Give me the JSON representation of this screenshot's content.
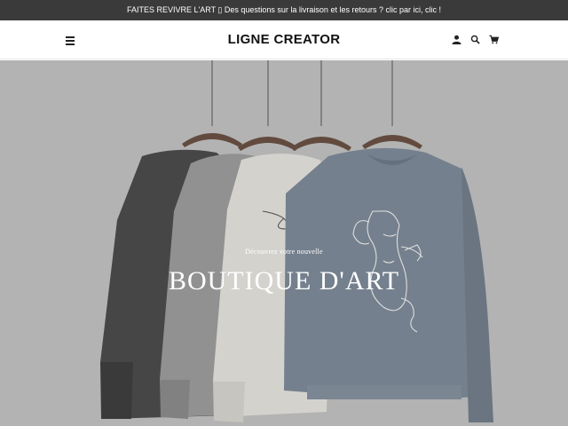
{
  "announcement": {
    "text": "FAITES REVIVRE L'ART ▯ Des questions sur la livraison et les retours ? clic par ici, clic !"
  },
  "header": {
    "logo": "LIGNE CREATOR",
    "icons": [
      "menu-icon",
      "account-icon",
      "search-icon",
      "cart-icon"
    ]
  },
  "hero": {
    "subtitle": "Découvrez votre nouvelle",
    "title": "BOUTIQUE D'ART"
  },
  "colors": {
    "announcement_bg": "#3a3a3a",
    "hero_bg": "#c4c4c4",
    "sweater_dark": "#4a4a4a",
    "sweater_gray": "#9b9b9b",
    "sweater_cream": "#e4e2dc",
    "sweater_blue": "#7d8a99"
  }
}
